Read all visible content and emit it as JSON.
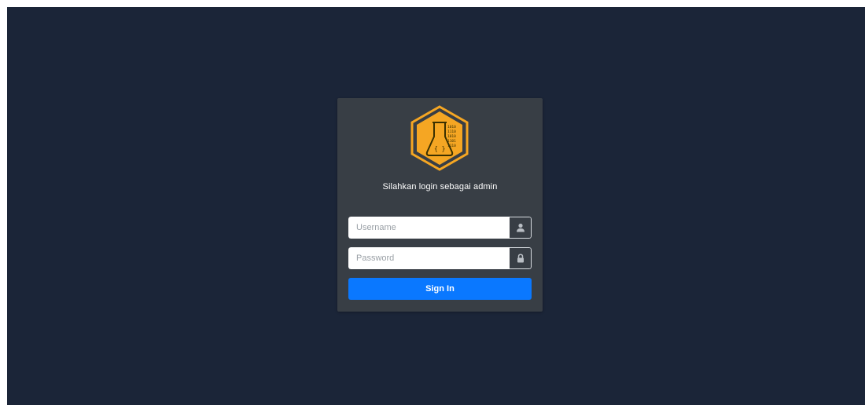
{
  "login": {
    "subtitle": "Silahkan login sebagai admin",
    "username": {
      "placeholder": "Username",
      "value": "",
      "icon": "user-icon"
    },
    "password": {
      "placeholder": "Password",
      "value": "",
      "icon": "lock-icon"
    },
    "signin_label": "Sign In",
    "logo": {
      "icon": "lab-flask-logo",
      "binary_text": [
        "1010",
        "1110",
        "1010",
        "1101",
        "1110"
      ]
    }
  },
  "colors": {
    "background": "#1b2538",
    "card": "#383e45",
    "accent": "#f5a623",
    "button": "#0a78ff"
  }
}
